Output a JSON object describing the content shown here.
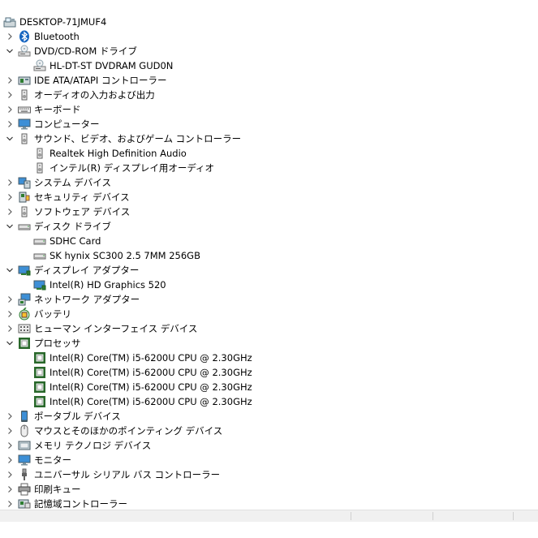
{
  "tree": [
    {
      "label": "DESKTOP-71JMUF4",
      "level": 0,
      "expand": "none",
      "icon": "computer-root-icon"
    },
    {
      "label": "Bluetooth",
      "level": 1,
      "expand": "collapsed",
      "icon": "bluetooth-icon"
    },
    {
      "label": "DVD/CD-ROM ドライブ",
      "level": 1,
      "expand": "expanded",
      "icon": "dvd-drive-icon"
    },
    {
      "label": "HL-DT-ST DVDRAM GUD0N",
      "level": 2,
      "expand": "none",
      "icon": "dvd-drive-icon"
    },
    {
      "label": "IDE ATA/ATAPI コントローラー",
      "level": 1,
      "expand": "collapsed",
      "icon": "ide-controller-icon"
    },
    {
      "label": "オーディオの入力および出力",
      "level": 1,
      "expand": "collapsed",
      "icon": "speaker-icon"
    },
    {
      "label": "キーボード",
      "level": 1,
      "expand": "collapsed",
      "icon": "keyboard-icon"
    },
    {
      "label": "コンピューター",
      "level": 1,
      "expand": "collapsed",
      "icon": "monitor-icon"
    },
    {
      "label": "サウンド、ビデオ、およびゲーム コントローラー",
      "level": 1,
      "expand": "expanded",
      "icon": "speaker-icon"
    },
    {
      "label": "Realtek High Definition Audio",
      "level": 2,
      "expand": "none",
      "icon": "speaker-icon"
    },
    {
      "label": "インテル(R) ディスプレイ用オーディオ",
      "level": 2,
      "expand": "none",
      "icon": "speaker-icon"
    },
    {
      "label": "システム デバイス",
      "level": 1,
      "expand": "collapsed",
      "icon": "system-device-icon"
    },
    {
      "label": "セキュリティ デバイス",
      "level": 1,
      "expand": "collapsed",
      "icon": "security-device-icon"
    },
    {
      "label": "ソフトウェア デバイス",
      "level": 1,
      "expand": "collapsed",
      "icon": "speaker-icon"
    },
    {
      "label": "ディスク ドライブ",
      "level": 1,
      "expand": "expanded",
      "icon": "disk-drive-icon"
    },
    {
      "label": "SDHC Card",
      "level": 2,
      "expand": "none",
      "icon": "disk-drive-icon"
    },
    {
      "label": "SK hynix SC300 2.5 7MM 256GB",
      "level": 2,
      "expand": "none",
      "icon": "disk-drive-icon"
    },
    {
      "label": "ディスプレイ アダプター",
      "level": 1,
      "expand": "expanded",
      "icon": "display-adapter-icon"
    },
    {
      "label": "Intel(R) HD Graphics 520",
      "level": 2,
      "expand": "none",
      "icon": "display-adapter-icon"
    },
    {
      "label": "ネットワーク アダプター",
      "level": 1,
      "expand": "collapsed",
      "icon": "network-adapter-icon"
    },
    {
      "label": "バッテリ",
      "level": 1,
      "expand": "collapsed",
      "icon": "battery-icon"
    },
    {
      "label": "ヒューマン インターフェイス デバイス",
      "level": 1,
      "expand": "collapsed",
      "icon": "hid-icon"
    },
    {
      "label": "プロセッサ",
      "level": 1,
      "expand": "expanded",
      "icon": "processor-icon"
    },
    {
      "label": "Intel(R) Core(TM) i5-6200U CPU @ 2.30GHz",
      "level": 2,
      "expand": "none",
      "icon": "processor-icon"
    },
    {
      "label": "Intel(R) Core(TM) i5-6200U CPU @ 2.30GHz",
      "level": 2,
      "expand": "none",
      "icon": "processor-icon"
    },
    {
      "label": "Intel(R) Core(TM) i5-6200U CPU @ 2.30GHz",
      "level": 2,
      "expand": "none",
      "icon": "processor-icon"
    },
    {
      "label": "Intel(R) Core(TM) i5-6200U CPU @ 2.30GHz",
      "level": 2,
      "expand": "none",
      "icon": "processor-icon"
    },
    {
      "label": "ポータブル デバイス",
      "level": 1,
      "expand": "collapsed",
      "icon": "portable-device-icon"
    },
    {
      "label": "マウスとそのほかのポインティング デバイス",
      "level": 1,
      "expand": "collapsed",
      "icon": "mouse-icon"
    },
    {
      "label": "メモリ テクノロジ デバイス",
      "level": 1,
      "expand": "collapsed",
      "icon": "memory-device-icon"
    },
    {
      "label": "モニター",
      "level": 1,
      "expand": "collapsed",
      "icon": "monitor-icon"
    },
    {
      "label": "ユニバーサル シリアル バス コントローラー",
      "level": 1,
      "expand": "collapsed",
      "icon": "usb-icon"
    },
    {
      "label": "印刷キュー",
      "level": 1,
      "expand": "collapsed",
      "icon": "printer-icon"
    },
    {
      "label": "記憶域コントローラー",
      "level": 1,
      "expand": "collapsed",
      "icon": "storage-controller-icon"
    }
  ],
  "colors": {
    "accent_blue": "#1e7bd6",
    "bluetooth": "#1565c0",
    "chip_green": "#2e6b2e",
    "monitor_blue": "#3d8fd6"
  }
}
